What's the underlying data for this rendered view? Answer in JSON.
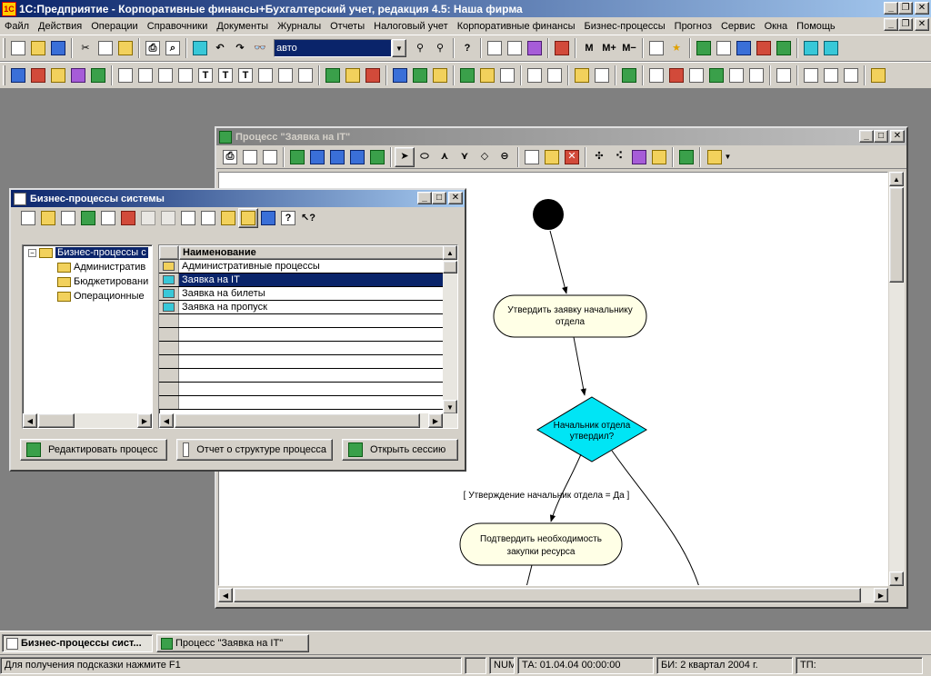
{
  "app": {
    "title": "1С:Предприятие - Корпоративные финансы+Бухгалтерский учет, редакция 4.5: Наша фирма"
  },
  "menu": [
    "Файл",
    "Действия",
    "Операции",
    "Справочники",
    "Документы",
    "Журналы",
    "Отчеты",
    "Налоговый учет",
    "Корпоративные финансы",
    "Бизнес-процессы",
    "Прогноз",
    "Сервис",
    "Окна",
    "Помощь"
  ],
  "toolbar": {
    "search_value": "авто",
    "m_label": "M",
    "m_plus_label": "M+",
    "m_minus_label": "M−"
  },
  "process_window": {
    "title": "Процесс \"Заявка на IT\""
  },
  "diagram": {
    "node1": "Утвердить заявку начальнику отдела",
    "node1_line1": "Утвердить заявку начальнику",
    "node1_line2": "отдела",
    "decision_line1": "Начальник отдела",
    "decision_line2": "утвердил?",
    "edge_label": "[ Утверждение начальник отдела = Да ]",
    "node2_line1": "Подтвердить необходимость",
    "node2_line2": "закупки ресурса"
  },
  "bp_window": {
    "title": "Бизнес-процессы системы",
    "tree": {
      "root": "Бизнес-процессы с",
      "children": [
        "Административ",
        "Бюджетировани",
        "Операционные"
      ]
    },
    "list": {
      "header": "Наименование",
      "rows": [
        "Административные процессы",
        "Заявка на IT",
        "Заявка на билеты",
        "Заявка на пропуск"
      ]
    },
    "buttons": {
      "edit": "Редактировать процесс",
      "report": "Отчет о структуре процесса",
      "session": "Открыть сессию"
    }
  },
  "taskbar": {
    "tab1": "Бизнес-процессы сист...",
    "tab2": "Процесс \"Заявка на IT\""
  },
  "status": {
    "hint": "Для получения подсказки нажмите F1",
    "num": "NUM",
    "ta": "ТА: 01.04.04  00:00:00",
    "bi": "БИ: 2 квартал 2004 г.",
    "tp": "ТП:"
  },
  "colors": {
    "active_title": "#0a246a",
    "decision_fill": "#00e5f5",
    "activity_fill": "#ffffe6"
  }
}
